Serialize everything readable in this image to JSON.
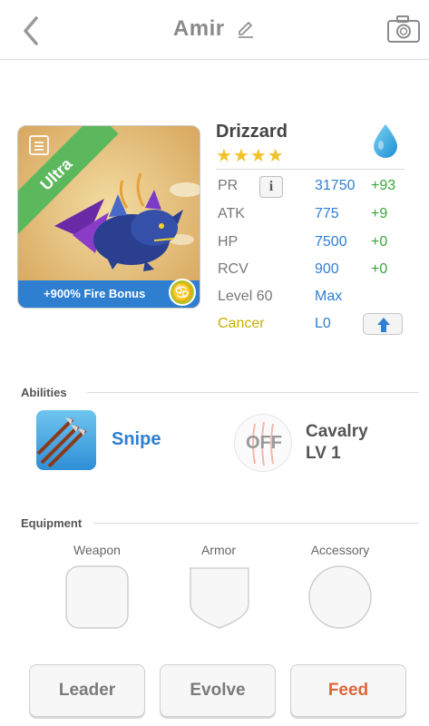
{
  "header": {
    "title": "Amir"
  },
  "card": {
    "rarity": "Ultra",
    "bonus": "+900% Fire Bonus",
    "zodiac_symbol": "♋"
  },
  "pet": {
    "name": "Drizzard",
    "stars": "★★★★",
    "element_icon": "water-drop-icon",
    "stats": [
      {
        "label": "PR",
        "value": "31750",
        "bonus": "+93"
      },
      {
        "label": "ATK",
        "value": "775",
        "bonus": "+9"
      },
      {
        "label": "HP",
        "value": "7500",
        "bonus": "+0"
      },
      {
        "label": "RCV",
        "value": "900",
        "bonus": "+0"
      }
    ],
    "level_label": "Level 60",
    "level_value": "Max",
    "sign_label": "Cancer",
    "sign_value": "L0"
  },
  "abilities": {
    "title": "Abilities",
    "primary": {
      "name": "Snipe"
    },
    "secondary": {
      "status": "OFF",
      "name_line1": "Cavalry",
      "name_line2": "LV 1"
    }
  },
  "equipment": {
    "title": "Equipment",
    "slots": [
      {
        "label": "Weapon"
      },
      {
        "label": "Armor"
      },
      {
        "label": "Accessory"
      }
    ]
  },
  "actions": {
    "leader": "Leader",
    "evolve": "Evolve",
    "feed": "Feed"
  },
  "colors": {
    "accent_blue": "#2f7fd1",
    "bonus_green": "#3aa53a",
    "star_gold": "#f2c22b",
    "sign_gold": "#c9b000",
    "feed_orange": "#e0643a"
  }
}
